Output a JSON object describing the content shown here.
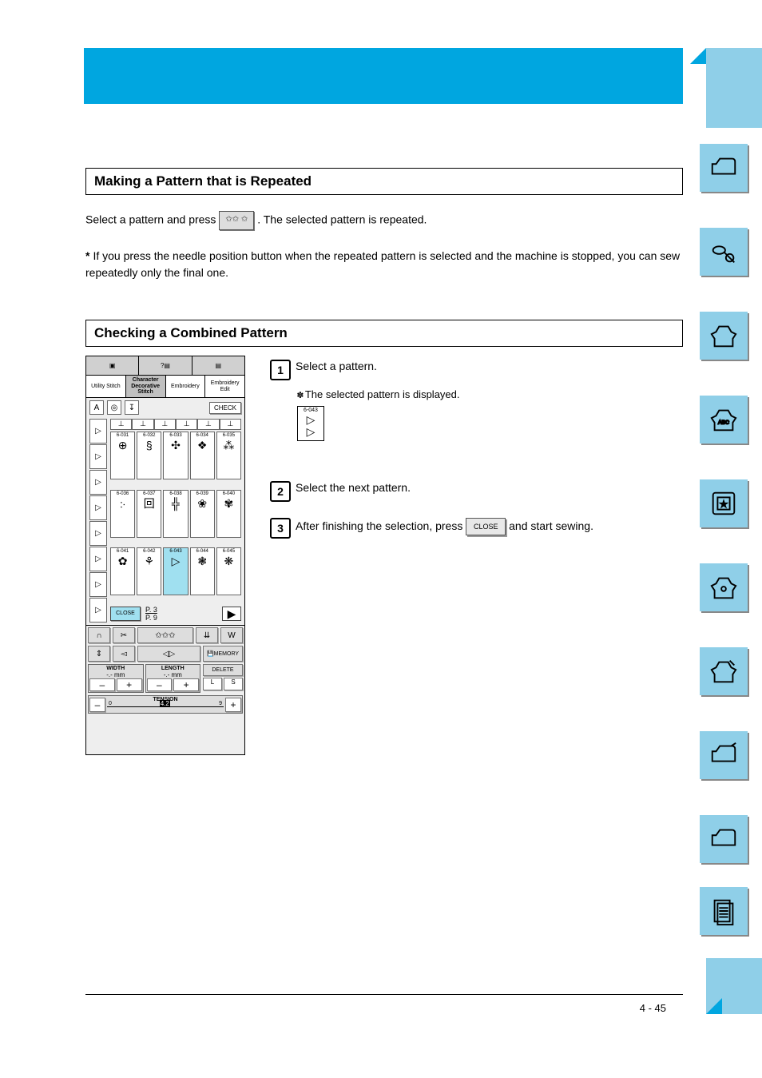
{
  "header": {
    "title1": "Making a Pattern that is Repeated",
    "title2": "Checking a Combined Pattern"
  },
  "para_a_pre": "Select a pattern and press ",
  "para_a_post": ". The selected pattern is repeated.",
  "inline_icon": "✩✩ ✩",
  "memo_bullet": "*",
  "memo_text": "If you press the needle position button when the repeated pattern is selected and the machine is stopped, you can sew repeatedly only the final one.",
  "steps": {
    "s1": {
      "num": "1",
      "text": "Select a pattern."
    },
    "s1_detail_star": "✽",
    "s1_detail": "The selected pattern is displayed.",
    "pattern_label": "6-043",
    "s2": {
      "num": "2",
      "text": "Select the next pattern."
    },
    "s3_pre": "After finishing the selection, press ",
    "s3": {
      "num": "3",
      "text": ""
    },
    "close_label": "CLOSE",
    "s3_post": " and start sewing."
  },
  "device": {
    "tabs": {
      "utility": "Utility\nStitch",
      "char": "Character\nDecorative\nStitch",
      "emb": "Embroidery",
      "edit": "Embroidery\nEdit"
    },
    "check": "CHECK",
    "close": "CLOSE",
    "page_top": "P. 3",
    "page_bot": "P. 9",
    "memory": "MEMORY",
    "delete": "DELETE",
    "width_label": "WIDTH",
    "length_label": "LENGTH",
    "unit": "mm",
    "width_val": "-.-",
    "length_val": "-.-",
    "tension_label": "TENSION",
    "tension_val": "4.2",
    "L": "L",
    "S": "S",
    "minus": "–",
    "plus": "+",
    "patterns": [
      [
        "6-031",
        "6-032",
        "6-033",
        "6-034",
        "6-035"
      ],
      [
        "6-036",
        "6-037",
        "6-038",
        "6-039",
        "6-040"
      ],
      [
        "6-041",
        "6-042",
        "6-043",
        "6-044",
        "6-045"
      ]
    ]
  },
  "page_num": "4 - 45"
}
